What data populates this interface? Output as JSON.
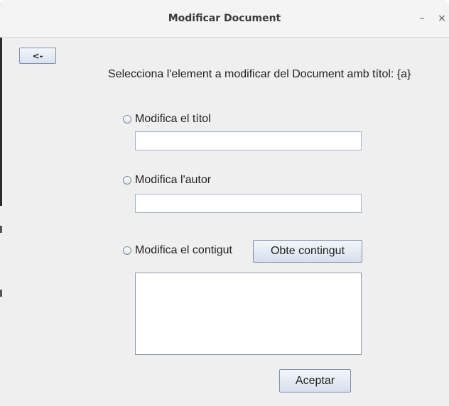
{
  "window": {
    "title": "Modificar Document",
    "minimize_glyph": "–",
    "close_glyph": "×"
  },
  "back_button": {
    "label": "<-"
  },
  "prompt": "Selecciona l'element a modificar del Document amb títol: {a}",
  "options": {
    "title": {
      "label": "Modifica el títol",
      "value": "",
      "selected": false
    },
    "author": {
      "label": "Modifica l'autor",
      "value": "",
      "selected": false
    },
    "content": {
      "label": "Modifica el contigut",
      "value": "",
      "selected": false
    }
  },
  "get_content_button": {
    "label": "Obte contingut"
  },
  "accept_button": {
    "label": "Aceptar"
  },
  "icons": {
    "minimize": "minimize-icon",
    "close": "close-icon",
    "radio": "radio-button"
  }
}
